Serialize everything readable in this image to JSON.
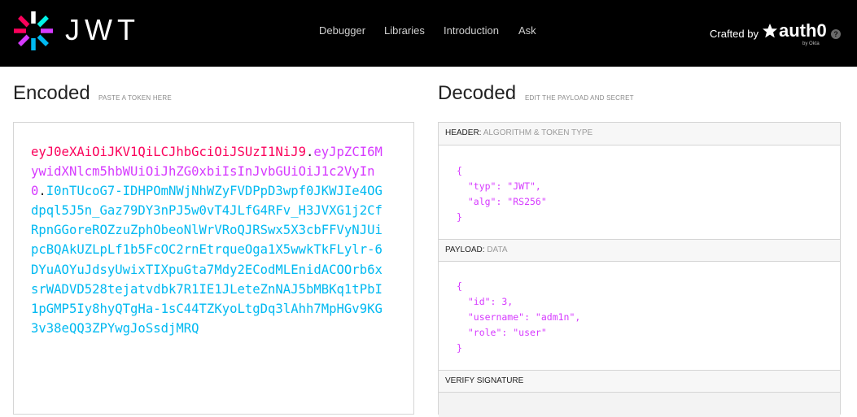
{
  "brand": {
    "wordmark": "JWT"
  },
  "nav": {
    "items": [
      "Debugger",
      "Libraries",
      "Introduction",
      "Ask"
    ]
  },
  "credit": {
    "crafted_by": "Crafted by",
    "auth0": "auth0",
    "by_okta": "by Okta",
    "help": "?"
  },
  "encoded": {
    "title": "Encoded",
    "hint": "PASTE A TOKEN HERE",
    "token_header": "eyJ0eXAiOiJKV1QiLCJhbGciOiJSUzI1NiJ9",
    "token_payload": "eyJpZCI6MywidXNlcm5hbWUiOiJhZG0xbiIsInJvbGUiOiJ1c2VyIn0",
    "token_signature": "I0nTUcoG7-IDHPOmNWjNhWZyFVDPpD3wpf0JKWJIe4OGdpql5J5n_Gaz79DY3nPJ5w0vT4JLfG4RFv_H3JVXG1j2CfRpnGGoreROZzuZphObeoNlWrVRoQJRSwx5X3cbFFVyNJUipcBQAkUZLpLf1b5FcOC2rnEtrqueOga1X5wwkTkFLylr-6DYuAOYuJdsyUwixTIXpuGta7Mdy2ECodMLEnidACOOrb6xsrWADVD528tejatvdbk7R1IE1JLeteZnNAJ5bMBKq1tPbI1pGMP5Iy8hyQTgHa-1sC44TZKyoLtgDq3lAhh7MpHGv9KG3v38eQQ3ZPYwgJoSsdjMRQ",
    "dot": ".",
    "colors": {
      "header": "#fb015b",
      "payload": "#d63aff",
      "signature": "#00b9f1"
    }
  },
  "decoded": {
    "title": "Decoded",
    "hint": "EDIT THE PAYLOAD AND SECRET",
    "header_label": "HEADER:",
    "header_sub": "ALGORITHM & TOKEN TYPE",
    "header_json": "{\n  \"typ\": \"JWT\",\n  \"alg\": \"RS256\"\n}",
    "payload_label": "PAYLOAD:",
    "payload_sub": "DATA",
    "payload_json": "{\n  \"id\": 3,\n  \"username\": \"adm1n\",\n  \"role\": \"user\"\n}",
    "verify_label": "VERIFY SIGNATURE"
  }
}
